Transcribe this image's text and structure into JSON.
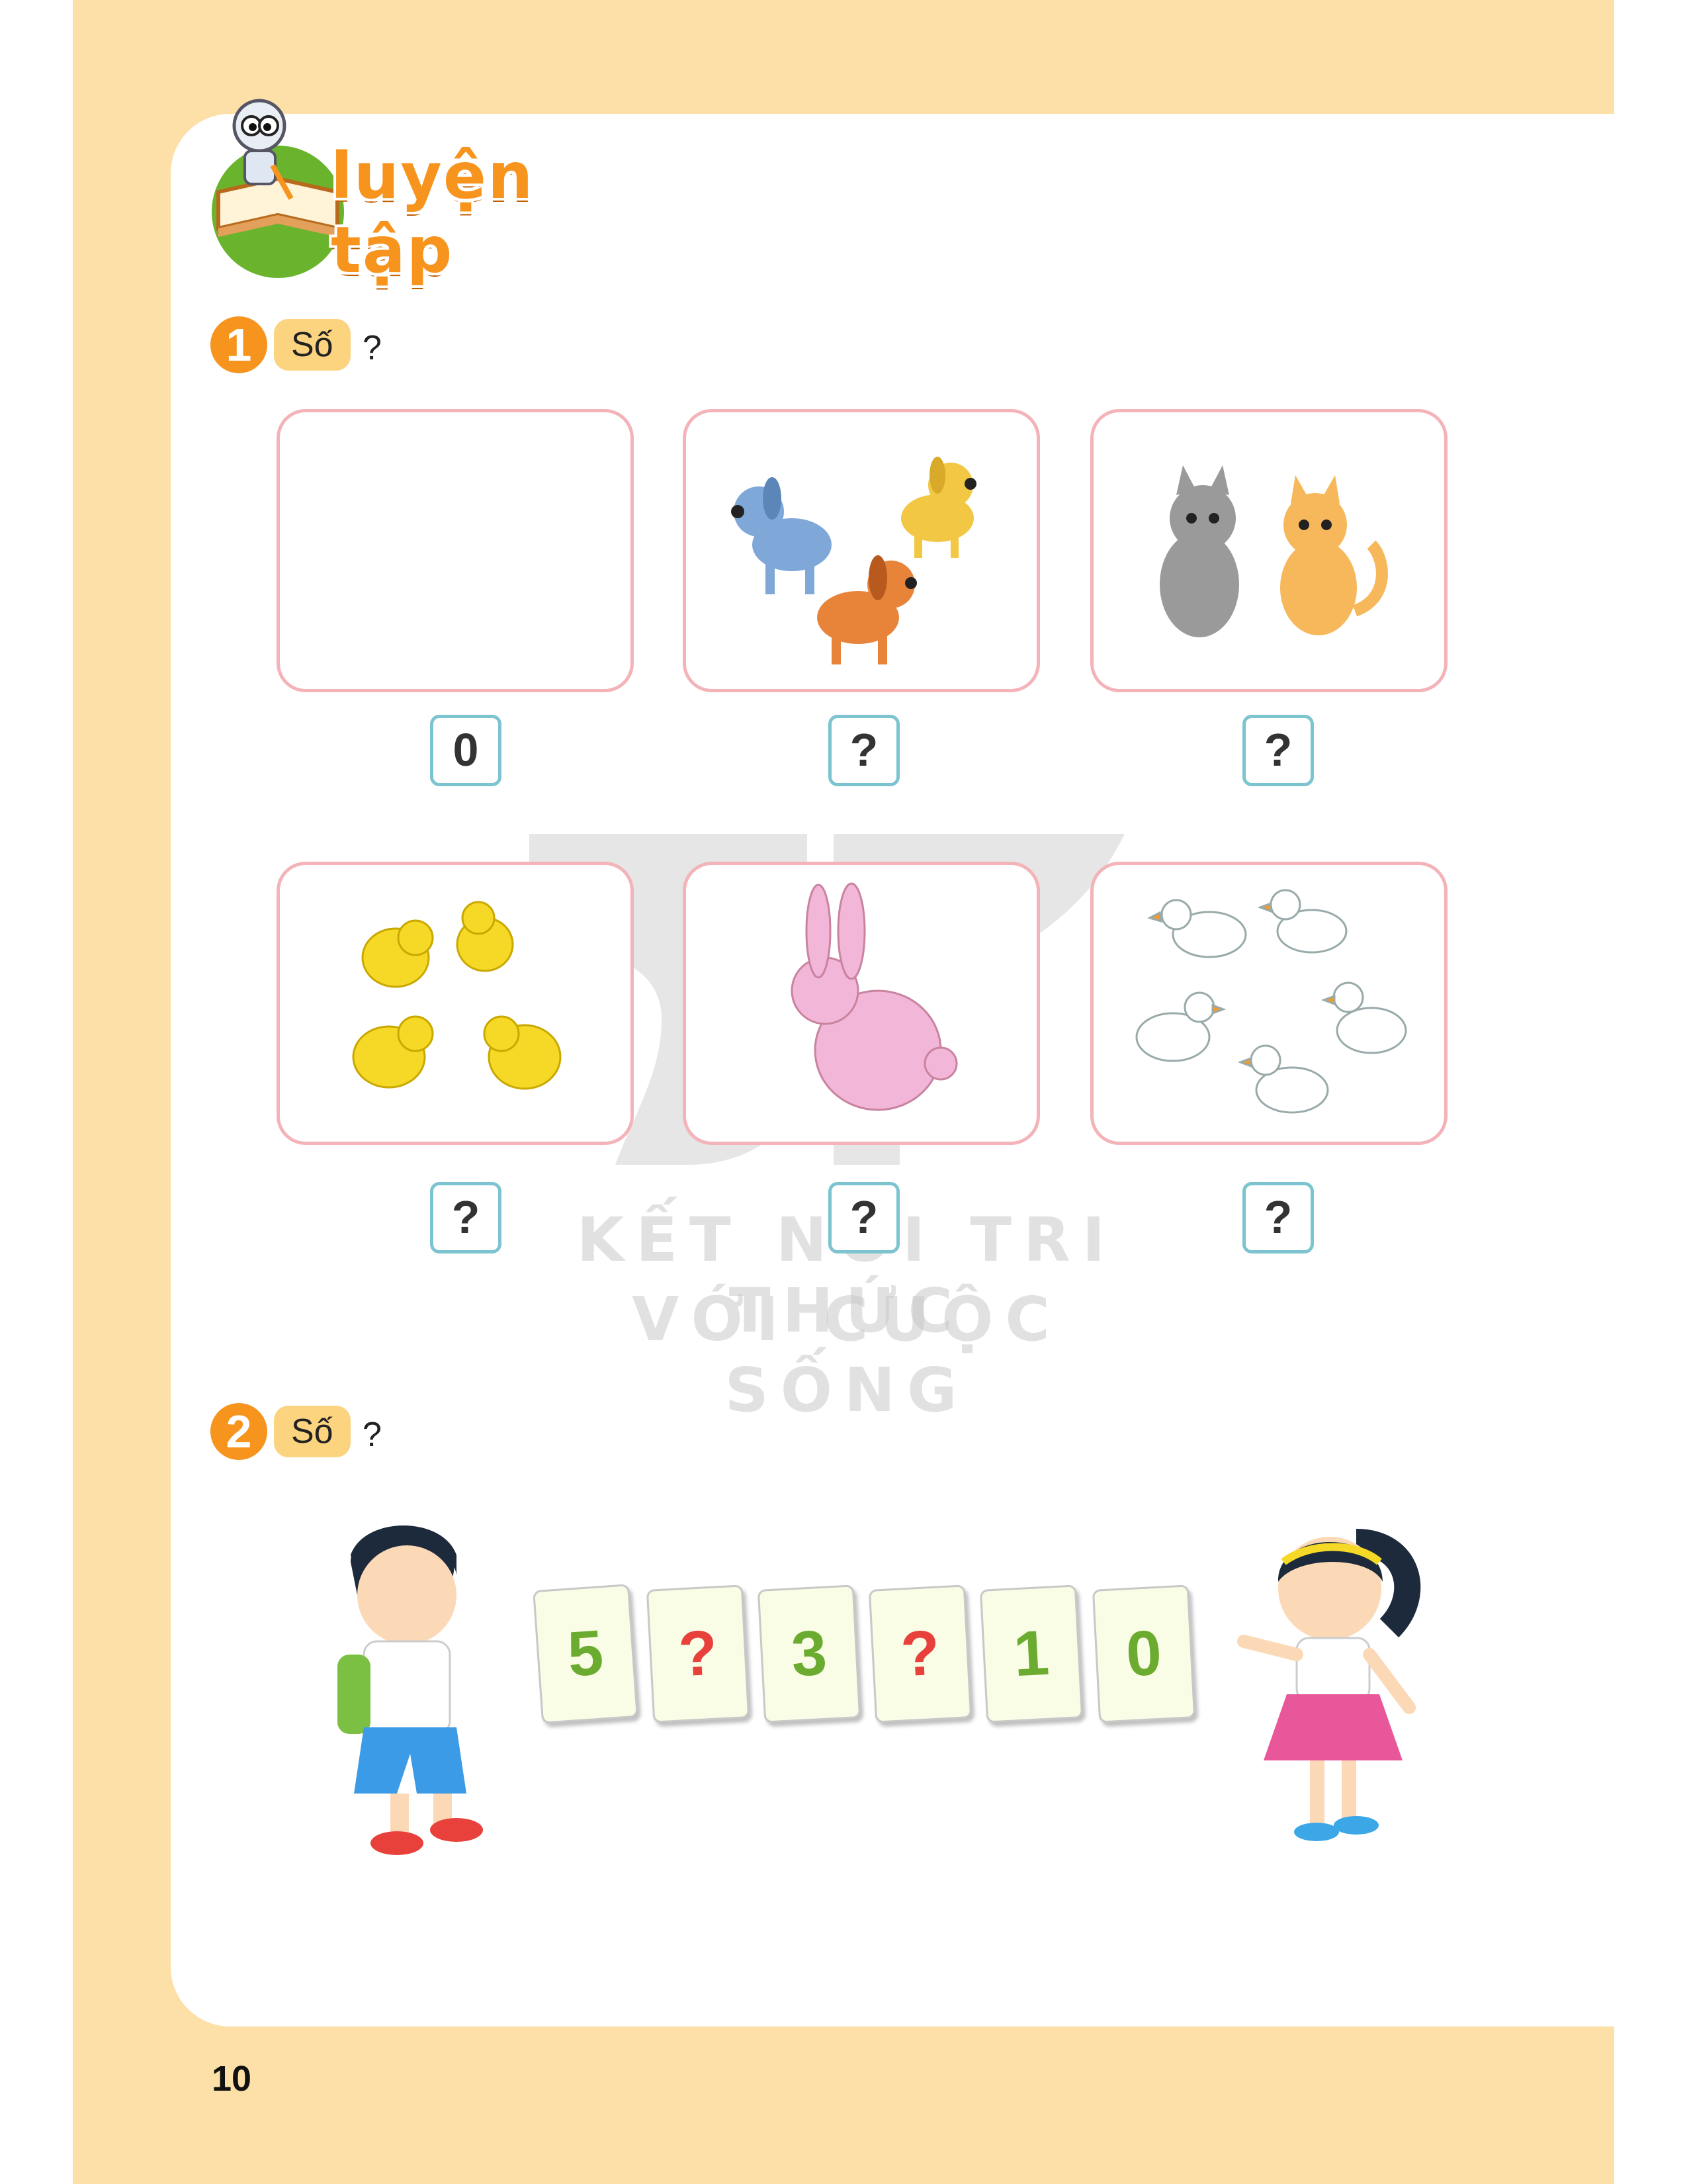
{
  "section": {
    "title": "luyện tập"
  },
  "exercises": [
    {
      "number": "1",
      "chip": "Số",
      "question_mark": "?"
    },
    {
      "number": "2",
      "chip": "Số",
      "question_mark": "?"
    }
  ],
  "exercise1": {
    "answers": [
      "0",
      "?",
      "?",
      "?",
      "?",
      "?"
    ],
    "pictures": [
      "empty",
      "3 dogs",
      "2 cats",
      "4 chicks",
      "1 rabbit",
      "5 ducks"
    ]
  },
  "exercise2": {
    "cards": [
      {
        "text": "5",
        "color": "#6bab2f"
      },
      {
        "text": "?",
        "color": "#e8413c"
      },
      {
        "text": "3",
        "color": "#6bab2f"
      },
      {
        "text": "?",
        "color": "#e8413c"
      },
      {
        "text": "1",
        "color": "#6bab2f"
      },
      {
        "text": "0",
        "color": "#6bab2f"
      }
    ]
  },
  "watermark": {
    "line1": "KẾT NỐI TRI THỨC",
    "line2": "VỚI CUỘC SỐNG"
  },
  "page_number": "10",
  "colors": {
    "accent": "#f7941d",
    "page_bg": "#fde0a8",
    "chip": "#fcd37e",
    "box_border": "#f3b3b8",
    "answer_border": "#7cc4cf"
  }
}
